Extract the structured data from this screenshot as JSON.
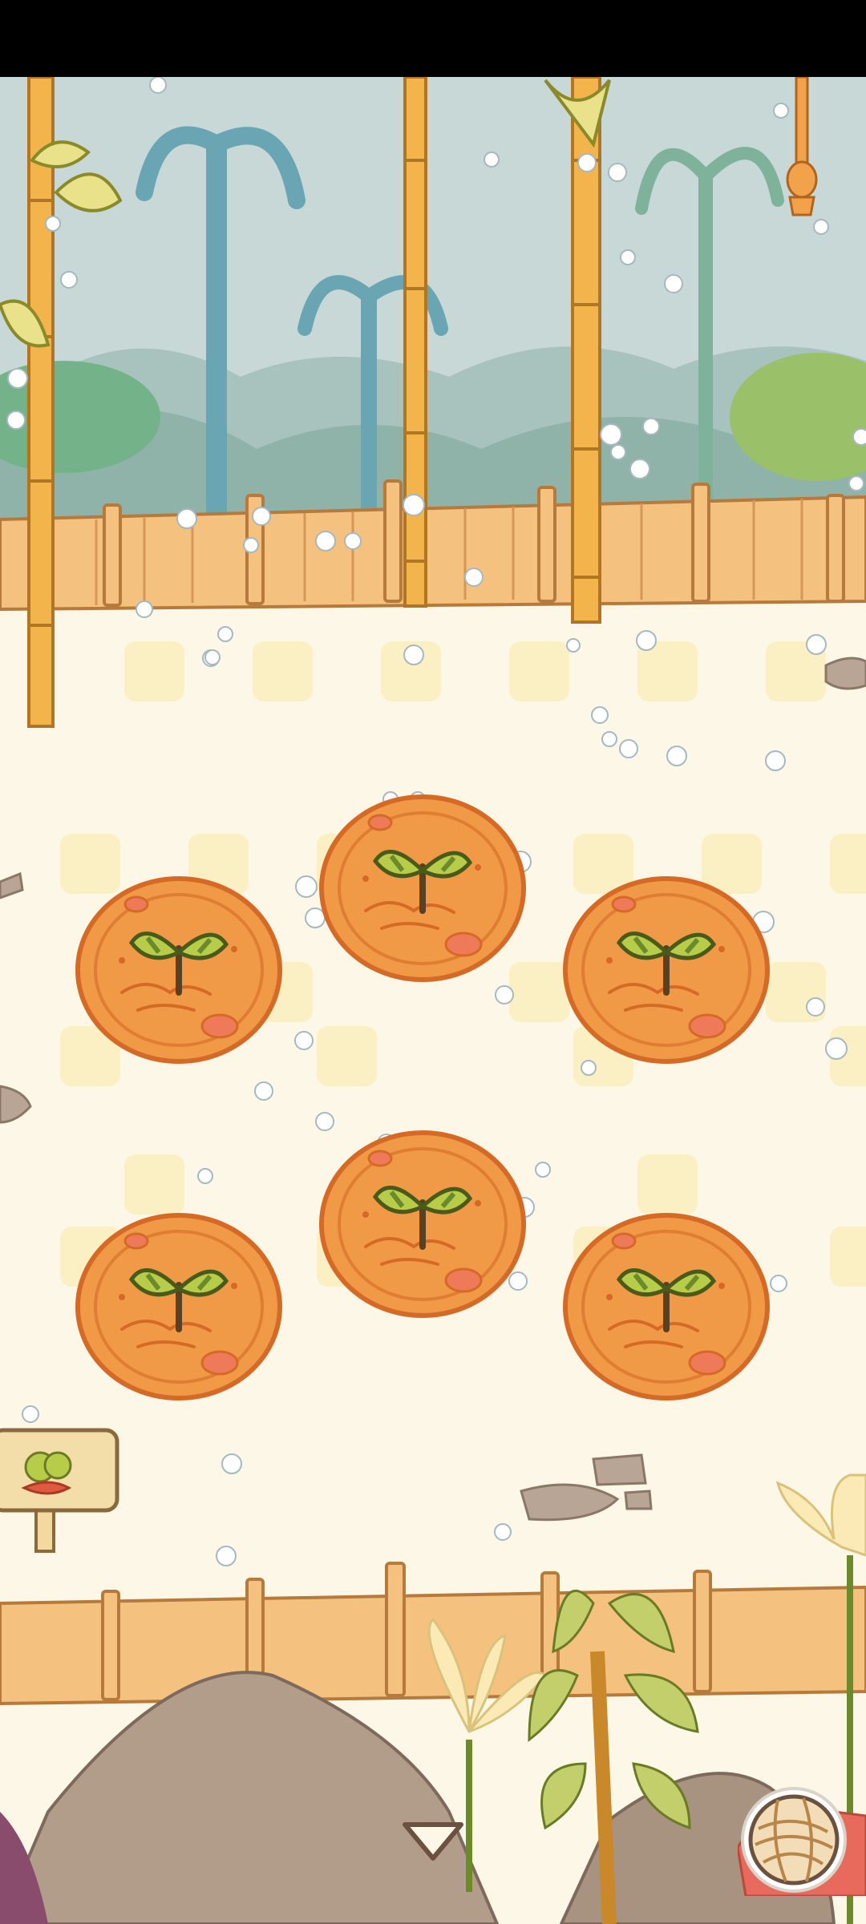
{
  "screen": {
    "name": "garden-plot-screen"
  },
  "colors": {
    "sky": "#c7d8d6",
    "ground": "#fdf7e8",
    "checker": "#fbf0c4",
    "fence": "#f4c27e",
    "fence_stroke": "#b67a3c",
    "bamboo": "#f2b44b",
    "soil": "#f09a48",
    "soil_dark": "#d46a26",
    "sprout": "#6b8a2c",
    "sprout_light": "#b7cd4a",
    "rock": "#b8a596"
  },
  "plots": [
    {
      "id": "plot-1",
      "state": "sprout"
    },
    {
      "id": "plot-2",
      "state": "sprout"
    },
    {
      "id": "plot-3",
      "state": "sprout"
    },
    {
      "id": "plot-4",
      "state": "sprout"
    },
    {
      "id": "plot-5",
      "state": "sprout"
    },
    {
      "id": "plot-6",
      "state": "sprout"
    }
  ],
  "icons": {
    "signpost": "signpost-sprout-icon",
    "collapse": "chevron-down-icon",
    "yarn": "yarn-ball-icon",
    "rope": "hanging-rope-icon"
  }
}
